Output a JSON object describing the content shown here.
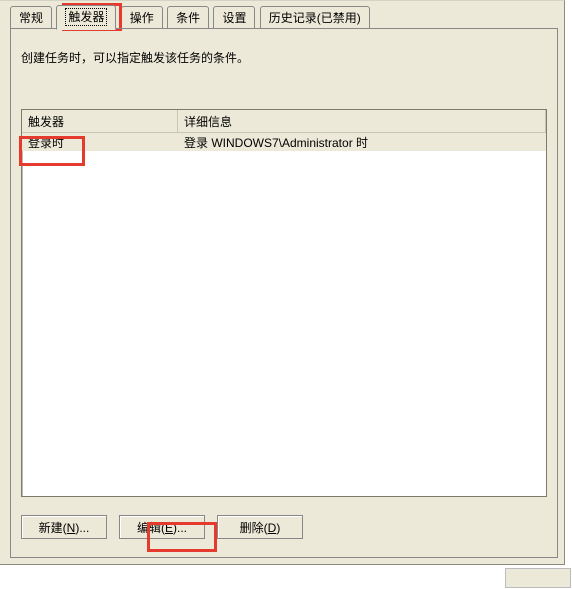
{
  "tabs": {
    "general": "常规",
    "triggers": "触发器",
    "actions": "操作",
    "conditions": "条件",
    "settings": "设置",
    "history": "历史记录(已禁用)",
    "activeIndex": 1
  },
  "description": "创建任务时，可以指定触发该任务的条件。",
  "list": {
    "cols": {
      "trigger": "触发器",
      "details": "详细信息"
    },
    "rows": [
      {
        "trigger": "登录时",
        "details": "登录 WINDOWS7\\Administrator 时"
      }
    ]
  },
  "buttons": {
    "new_pre": "新建(",
    "new_u": "N",
    "new_post": ")...",
    "edit_pre": "编辑(",
    "edit_u": "E",
    "edit_post": ")...",
    "del_pre": "删除(",
    "del_u": "D",
    "del_post": ")"
  }
}
